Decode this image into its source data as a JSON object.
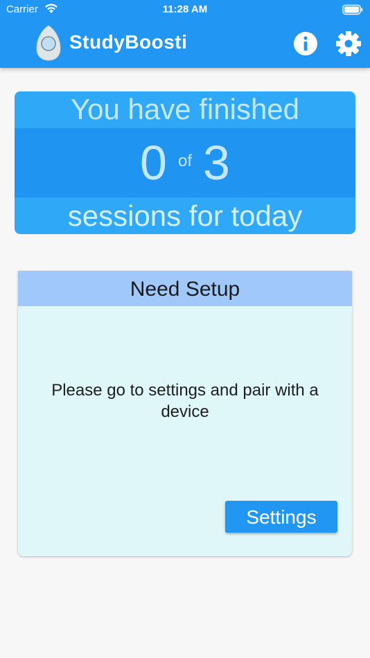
{
  "status_bar": {
    "carrier": "Carrier",
    "time": "11:28 AM"
  },
  "app_bar": {
    "title": "StudyBoosti",
    "icons": [
      "logo-icon",
      "info-icon",
      "gear-icon"
    ]
  },
  "progress": {
    "line1": "You have finished",
    "completed": "0",
    "of_label": "of",
    "total": "3",
    "line3": "sessions for today"
  },
  "setup_card": {
    "title": "Need Setup",
    "message": "Please go to settings and pair with a device",
    "button_label": "Settings"
  },
  "colors": {
    "primary": "#2196f3",
    "card_light": "#2fa8f7",
    "card_dark": "#2094f1",
    "setup_header": "#a0c8fb",
    "setup_body": "#e0f7fa"
  }
}
